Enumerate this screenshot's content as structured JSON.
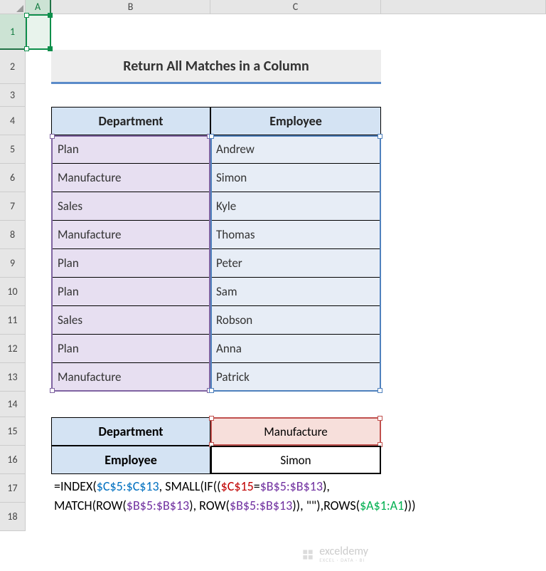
{
  "columns": [
    "A",
    "B",
    "C"
  ],
  "rows": [
    "1",
    "2",
    "3",
    "4",
    "5",
    "6",
    "7",
    "8",
    "9",
    "10",
    "11",
    "12",
    "13",
    "14",
    "15",
    "16",
    "17",
    "18"
  ],
  "title": "Return All Matches in a Column",
  "headers": {
    "dept": "Department",
    "emp": "Employee"
  },
  "table": [
    {
      "dept": "Plan",
      "emp": "Andrew"
    },
    {
      "dept": "Manufacture",
      "emp": "Simon"
    },
    {
      "dept": "Sales",
      "emp": "Kyle"
    },
    {
      "dept": "Manufacture",
      "emp": "Thomas"
    },
    {
      "dept": "Plan",
      "emp": "Peter"
    },
    {
      "dept": "Plan",
      "emp": "Sam"
    },
    {
      "dept": "Sales",
      "emp": "Robson"
    },
    {
      "dept": "Plan",
      "emp": "Anna"
    },
    {
      "dept": "Manufacture",
      "emp": "Patrick"
    }
  ],
  "lookup": {
    "dept_label": "Department",
    "dept_value": "Manufacture",
    "emp_label": "Employee",
    "emp_value": "Simon"
  },
  "formula": {
    "p1": "=INDEX(",
    "p2": "$C$5:$C$13",
    "p3": ", SMALL(IF((",
    "p4": "$C$15",
    "p5": "=",
    "p6": "$B$5:$B$13",
    "p7": "),",
    "p8": "MATCH(ROW(",
    "p9": "$B$5:$B$13",
    "p10": "), ROW(",
    "p11": "$B$5:$B$13",
    "p12": ")), \"\"),ROWS(",
    "p13": "$A$1:A1",
    "p14": ")))"
  },
  "watermark": {
    "title": "exceldemy",
    "sub": "EXCEL · DATA · BI"
  },
  "chart_data": {
    "type": "table",
    "title": "Return All Matches in a Column",
    "columns": [
      "Department",
      "Employee"
    ],
    "rows": [
      [
        "Plan",
        "Andrew"
      ],
      [
        "Manufacture",
        "Simon"
      ],
      [
        "Sales",
        "Kyle"
      ],
      [
        "Manufacture",
        "Thomas"
      ],
      [
        "Plan",
        "Peter"
      ],
      [
        "Plan",
        "Sam"
      ],
      [
        "Sales",
        "Robson"
      ],
      [
        "Plan",
        "Anna"
      ],
      [
        "Manufacture",
        "Patrick"
      ]
    ],
    "lookup": {
      "Department": "Manufacture",
      "Employee": "Simon"
    },
    "formula": "=INDEX($C$5:$C$13, SMALL(IF(($C$15=$B$5:$B$13), MATCH(ROW($B$5:$B$13), ROW($B$5:$B$13)), \"\"),ROWS($A$1:A1)))"
  }
}
